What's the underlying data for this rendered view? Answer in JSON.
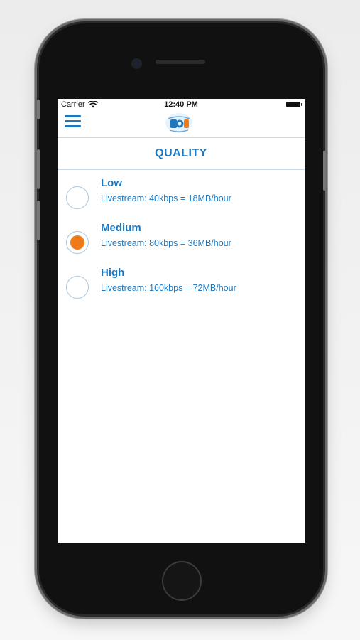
{
  "status_bar": {
    "carrier": "Carrier",
    "time": "12:40 PM",
    "wifi_icon": "wifi-icon",
    "battery_icon": "battery-icon"
  },
  "nav": {
    "menu_icon": "hamburger-menu-icon",
    "logo": "app-logo"
  },
  "page": {
    "title": "QUALITY"
  },
  "options": [
    {
      "label": "Low",
      "description": "Livestream: 40kbps = 18MB/hour",
      "selected": false
    },
    {
      "label": "Medium",
      "description": "Livestream: 80kbps = 36MB/hour",
      "selected": true
    },
    {
      "label": "High",
      "description": "Livestream: 160kbps = 72MB/hour",
      "selected": false
    }
  ],
  "colors": {
    "accent": "#1e78bf",
    "selected_radio": "#ef7a1a",
    "divider": "#c9dbe9"
  }
}
